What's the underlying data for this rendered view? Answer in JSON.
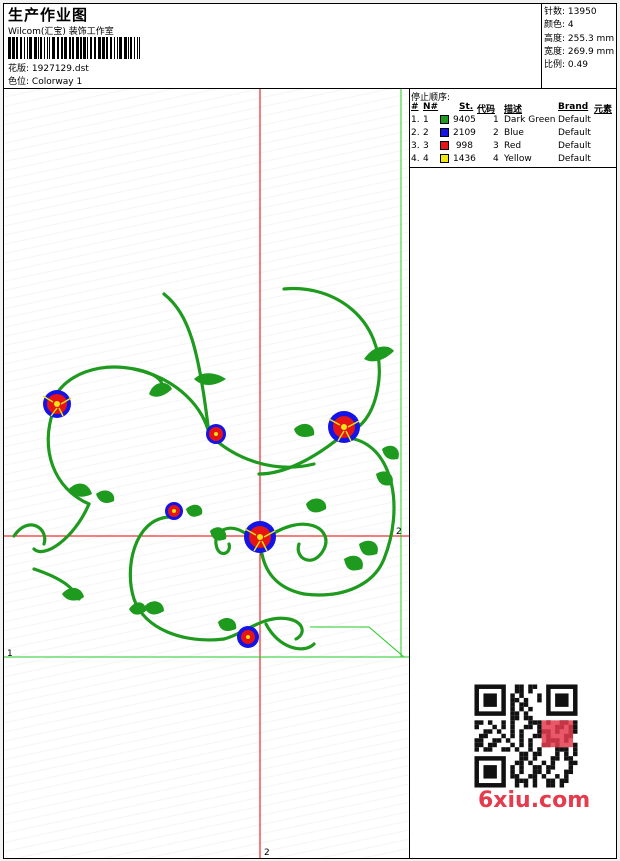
{
  "header": {
    "title": "生产作业图",
    "studio": "Wilcom(汇宝) 装饰工作室",
    "pattern_label": "花版:",
    "pattern_value": "1927129.dst",
    "colorway_label": "色位:",
    "colorway_value": "Colorway 1"
  },
  "stats": {
    "stitches_label": "针数:",
    "stitches_value": "13950",
    "colors_label": "颜色:",
    "colors_value": "4",
    "height_label": "高度:",
    "height_value": "255.3 mm",
    "width_label": "宽度:",
    "width_value": "269.9 mm",
    "scale_label": "比例:",
    "scale_value": "0.49"
  },
  "stop_sequence": {
    "title": "停止顺序:",
    "columns": [
      "#",
      "N#",
      "St.",
      "代码",
      "描述",
      "Brand",
      "元素"
    ],
    "rows": [
      {
        "idx": "1.",
        "n": "1",
        "color": "#1e9a1e",
        "st": "9405",
        "code": "1",
        "desc": "Dark Green",
        "brand": "Default"
      },
      {
        "idx": "2.",
        "n": "2",
        "color": "#1414e6",
        "st": "2109",
        "code": "2",
        "desc": "Blue",
        "brand": "Default"
      },
      {
        "idx": "3.",
        "n": "3",
        "color": "#e61414",
        "st": "998",
        "code": "3",
        "desc": "Red",
        "brand": "Default"
      },
      {
        "idx": "4.",
        "n": "4",
        "color": "#f0e614",
        "st": "1436",
        "code": "4",
        "desc": "Yellow",
        "brand": "Default"
      }
    ]
  },
  "axes": {
    "x_marker_bottom": "2",
    "x_marker_right": "2",
    "y_marker_left": "1"
  },
  "watermark": "6xiu.com",
  "colors": {
    "stem": "#1e9a1e",
    "petal_blue": "#1414e6",
    "petal_red": "#e61414",
    "center": "#f0e614",
    "guide_red": "#e60000",
    "guide_green": "#22cc22"
  }
}
